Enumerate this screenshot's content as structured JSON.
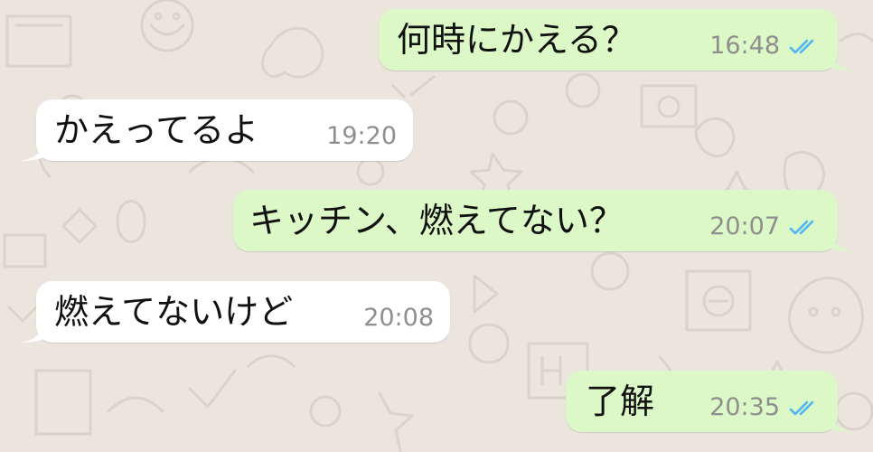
{
  "conversation": {
    "messages": [
      {
        "direction": "out",
        "text": "何時にかえる？",
        "time": "16:48",
        "status": "read"
      },
      {
        "direction": "in",
        "text": "かえってるよ",
        "time": "19:20"
      },
      {
        "direction": "out",
        "text": "キッチン、燃えてない？",
        "time": "20:07",
        "status": "read"
      },
      {
        "direction": "in",
        "text": "燃えてないけど",
        "time": "20:08"
      },
      {
        "direction": "out",
        "text": "了解",
        "time": "20:35",
        "status": "read"
      }
    ]
  },
  "colors": {
    "outgoing_bubble": "#dcf8c6",
    "incoming_bubble": "#ffffff",
    "wallpaper": "#ece5dd",
    "read_ticks": "#4fb6f1",
    "time_text": "#8e8e8e"
  },
  "icons": {
    "read_receipt": "double-check-icon"
  }
}
